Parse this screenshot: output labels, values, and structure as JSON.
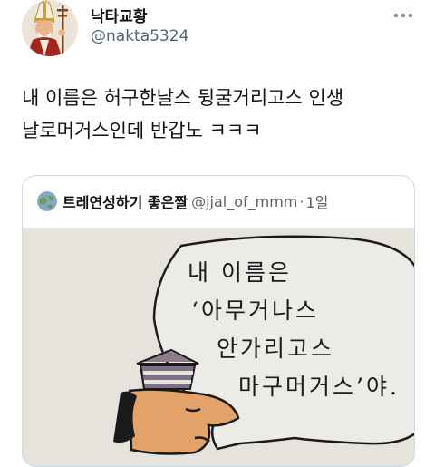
{
  "author": {
    "name": "낙타교황",
    "handle": "@nakta5324"
  },
  "more_icon": "more-horizontal-icon",
  "tweet": {
    "line1": "내 이름은 허구한날스 뒹굴거리고스 인생",
    "line2": "날로머거스인데 반갑노 ㅋㅋㅋ"
  },
  "quote": {
    "name": "트레연성하기 좋은짤",
    "handle": "@jjal_of_mmm",
    "separator": "·",
    "time": "1일",
    "bubble_lines": [
      "내 이름은",
      "‘아무거나스",
      "안가리고스",
      "마구머거스’야."
    ]
  },
  "colors": {
    "text_primary": "#0f1419",
    "text_secondary": "#536471",
    "border": "#cfd9de",
    "cartoon_bg": "#e6e2dc"
  }
}
